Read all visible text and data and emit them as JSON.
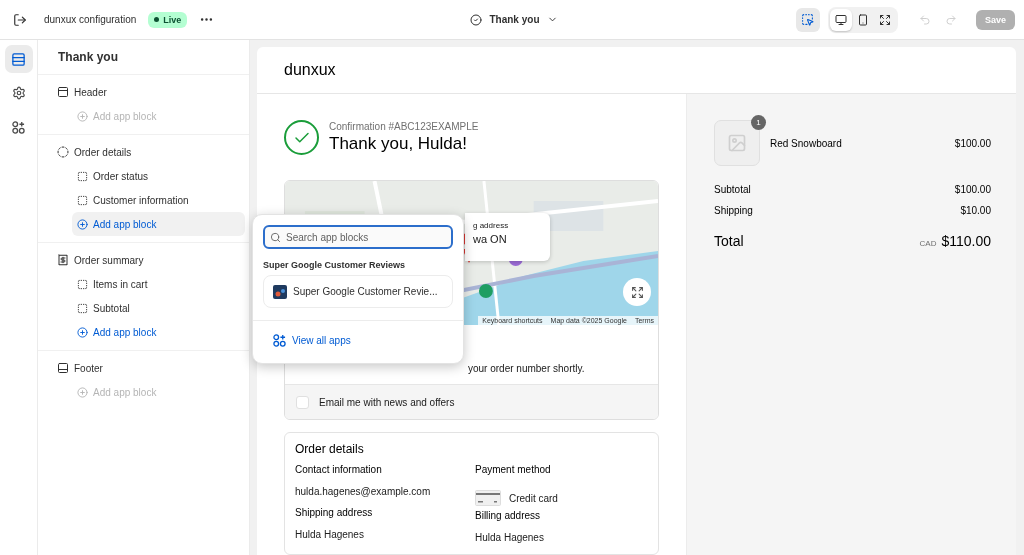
{
  "topbar": {
    "title": "dunxux configuration",
    "status": "Live",
    "page": "Thank you",
    "inspector": {
      "selected": true
    },
    "view_modes": [
      {
        "kind": "desktop",
        "selected": true
      },
      {
        "kind": "mobile",
        "selected": false
      },
      {
        "kind": "full",
        "selected": false
      }
    ],
    "undo": {
      "disabled": true
    },
    "redo": {
      "disabled": true
    },
    "save": {
      "label": "Save",
      "disabled": true
    }
  },
  "rail": [
    {
      "kind": "sections",
      "selected": true
    },
    {
      "kind": "settings",
      "selected": false
    },
    {
      "kind": "apps",
      "selected": false
    }
  ],
  "sidebar": {
    "title": "Thank you",
    "sections": [
      {
        "kind": "header",
        "name": "Header",
        "blocks": [
          {
            "kind": "add",
            "label": "Add app block",
            "disabled": true,
            "selected": false
          }
        ]
      },
      {
        "kind": "main",
        "name": "Order details",
        "blocks": [
          {
            "kind": "block",
            "label": "Order status",
            "disabled": false,
            "selected": false
          },
          {
            "kind": "block",
            "label": "Customer information",
            "disabled": false,
            "selected": false
          },
          {
            "kind": "add",
            "label": "Add app block",
            "disabled": false,
            "selected": true
          }
        ]
      },
      {
        "kind": "summary",
        "name": "Order summary",
        "blocks": [
          {
            "kind": "block",
            "label": "Items in cart",
            "disabled": false,
            "selected": false
          },
          {
            "kind": "block",
            "label": "Subtotal",
            "disabled": false,
            "selected": false
          },
          {
            "kind": "add",
            "label": "Add app block",
            "disabled": false,
            "selected": false
          }
        ]
      },
      {
        "kind": "footer",
        "name": "Footer",
        "blocks": [
          {
            "kind": "add",
            "label": "Add app block",
            "disabled": true,
            "selected": false
          }
        ]
      }
    ]
  },
  "preview": {
    "store": "dunxux",
    "confirmation": "Confirmation #ABC123EXAMPLE",
    "heading": "Thank you, Hulda!",
    "map": {
      "kind": "picture",
      "popup": [
        "g address",
        "wa ON"
      ],
      "attribution": [
        "Keyboard shortcuts",
        "Map data ©2025 Google",
        "Terms"
      ]
    },
    "notice": "your order number shortly.",
    "newsletter": {
      "label": "Email me with news and offers",
      "checked": false
    },
    "order_details": {
      "title": "Order details",
      "columns": [
        {
          "items": [
            {
              "kind": "label",
              "text": "Contact information"
            },
            {
              "kind": "value",
              "text": "hulda.hagenes@example.com"
            },
            {
              "kind": "label",
              "text": "Shipping address"
            },
            {
              "kind": "value",
              "text": "Hulda Hagenes"
            }
          ]
        },
        {
          "items": [
            {
              "kind": "label",
              "text": "Payment method"
            },
            {
              "kind": "card",
              "text": "Credit card"
            },
            {
              "kind": "label",
              "text": "Billing address"
            },
            {
              "kind": "value",
              "text": "Hulda Hagenes"
            }
          ]
        }
      ]
    },
    "summary": {
      "items": [
        {
          "name": "Red Snowboard",
          "quantity": "1",
          "price": "$100.00"
        }
      ],
      "lines": [
        {
          "label": "Subtotal",
          "value": "$100.00"
        },
        {
          "label": "Shipping",
          "value": "$10.00"
        }
      ],
      "total": {
        "label": "Total",
        "currency": "CAD",
        "value": "$110.00"
      }
    }
  },
  "app_picker": {
    "placeholder": "Search app blocks",
    "group": "Super Google Customer Reviews",
    "apps": [
      {
        "name": "Super Google Customer Revie..."
      }
    ],
    "link": "View all apps"
  }
}
